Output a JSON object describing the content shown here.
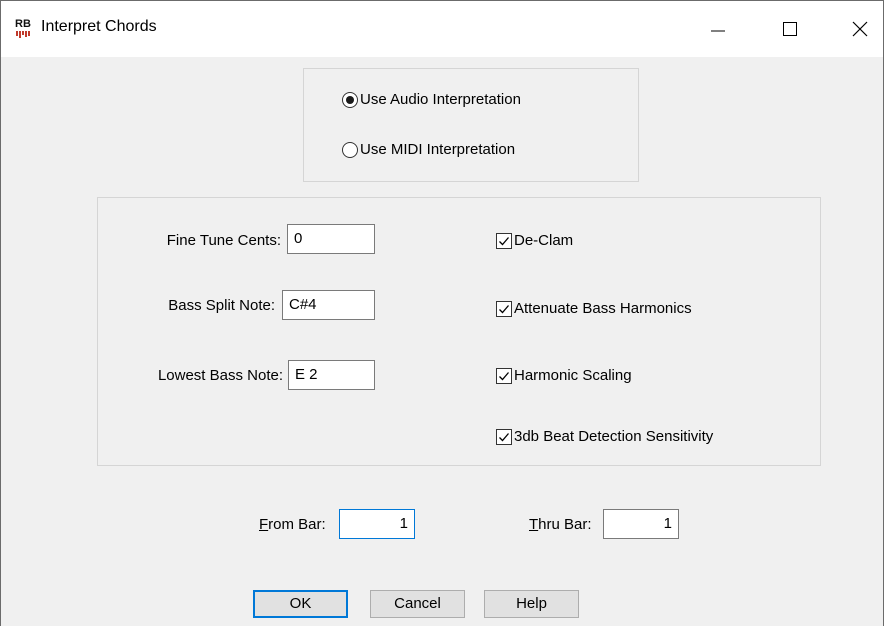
{
  "window": {
    "title": "Interpret Chords",
    "icon_text": "RB",
    "icon": "app-icon"
  },
  "interpretation": {
    "options": [
      {
        "label": "Use Audio Interpretation",
        "selected": true
      },
      {
        "label": "Use MIDI Interpretation",
        "selected": false
      }
    ]
  },
  "settings": {
    "fine_tune_label": "Fine Tune Cents:",
    "fine_tune_value": "0",
    "bass_split_label": "Bass Split Note:",
    "bass_split_value": "C#4",
    "lowest_bass_label": "Lowest Bass Note:",
    "lowest_bass_value": "E 2",
    "checks": [
      {
        "label": "De-Clam",
        "checked": true
      },
      {
        "label": "Attenuate Bass Harmonics",
        "checked": true
      },
      {
        "label": "Harmonic Scaling",
        "checked": true
      },
      {
        "label": "3db Beat Detection Sensitivity",
        "checked": true
      }
    ]
  },
  "range": {
    "from_label_mnemonic": "F",
    "from_label_rest": "rom Bar:",
    "from_value": "1",
    "thru_label_mnemonic": "T",
    "thru_label_rest": "hru Bar:",
    "thru_value": "1"
  },
  "buttons": {
    "ok": "OK",
    "cancel": "Cancel",
    "help": "Help"
  }
}
